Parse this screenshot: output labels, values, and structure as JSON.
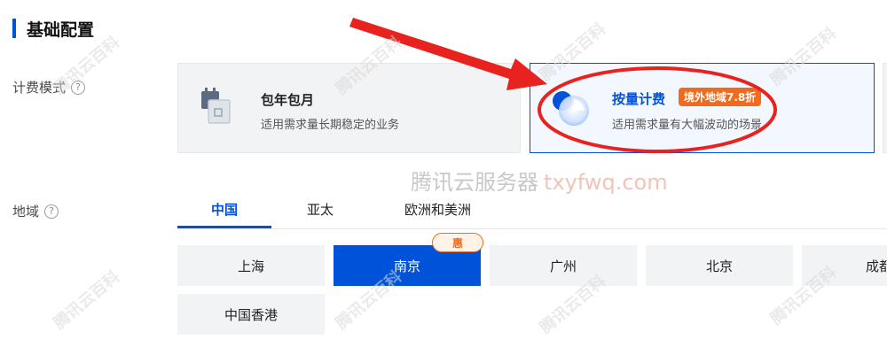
{
  "section": {
    "title": "基础配置"
  },
  "billing": {
    "label": "计费模式",
    "options": [
      {
        "title": "包年包月",
        "desc": "适用需求量长期稳定的业务"
      },
      {
        "title": "按量计费",
        "badge": "境外地域7.8折",
        "desc": "适用需求量有大幅波动的场景"
      }
    ]
  },
  "region": {
    "label": "地域",
    "tabs": [
      "中国",
      "亚太",
      "欧洲和美洲"
    ],
    "cities": [
      "上海",
      "南京",
      "广州",
      "北京",
      "成都",
      "中国香港"
    ],
    "promo_badge": "惠"
  },
  "watermark": {
    "center_text": "腾讯云服务器",
    "center_url": "txyfwq.com",
    "diagonal": "腾讯云百科"
  },
  "colors": {
    "accent": "#0052d9",
    "promo": "#f26a1b",
    "annotation": "#e8231f"
  }
}
